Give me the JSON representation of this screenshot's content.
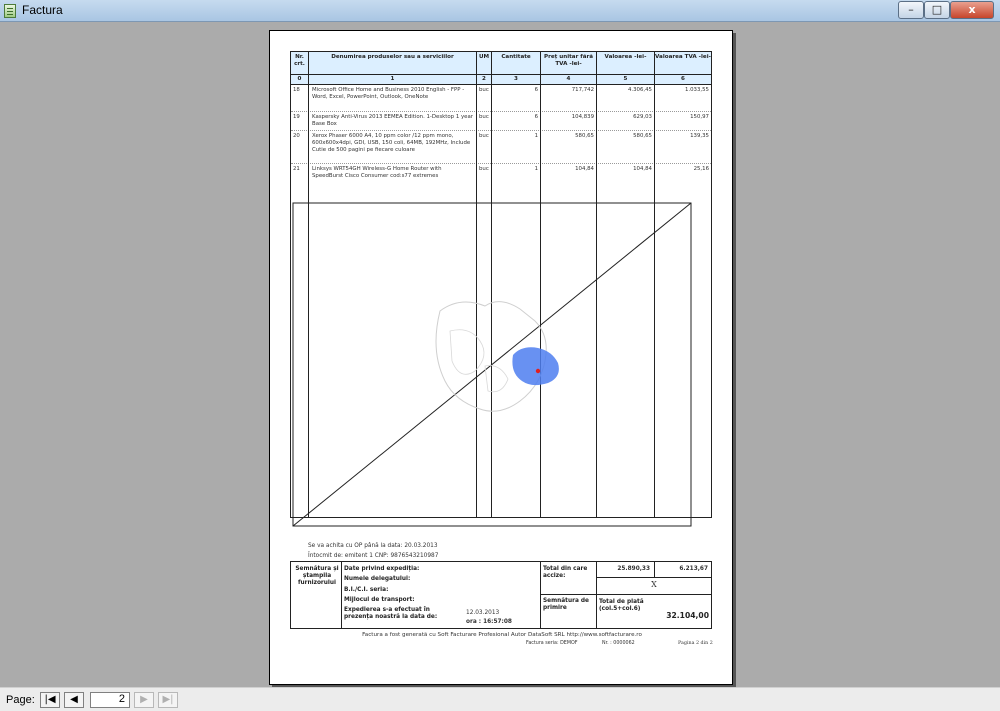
{
  "window": {
    "title": "Factura",
    "min_label": "–",
    "max_label": "□",
    "close_label": "x"
  },
  "table": {
    "headers": [
      "Nr. crt.",
      "Denumirea produselor sau a serviciilor",
      "UM",
      "Cantitate",
      "Preț unitar fără TVA -lei-",
      "Valoarea -lei-",
      "Valoarea TVA -lei-"
    ],
    "col_numbers": [
      "0",
      "1",
      "2",
      "3",
      "4",
      "5",
      "6"
    ],
    "rows": [
      {
        "nr": "18",
        "name": "Microsoft Office Home and Business 2010 English - FPP - Word, Excel, PowerPoint, Outlook, OneNote",
        "um": "buc",
        "qty": "6",
        "price": "717,742",
        "value": "4.306,45",
        "vat": "1.033,55"
      },
      {
        "nr": "19",
        "name": "Kaspersky Anti-Virus 2013 EEMEA Edition. 1-Desktop 1 year Base Box",
        "um": "buc",
        "qty": "6",
        "price": "104,839",
        "value": "629,03",
        "vat": "150,97"
      },
      {
        "nr": "20",
        "name": "Xerox Phaser 6000 A4, 10 ppm color /12 ppm mono, 600x600x4dpi, GDI, USB, 150 coli, 64MB, 192MHz, Include Cutie de 500 pagini pe fiecare culoare",
        "um": "buc",
        "qty": "1",
        "price": "580,65",
        "value": "580,65",
        "vat": "139,35"
      },
      {
        "nr": "21",
        "name": "Linksys WRT54GH Wireless-G Home Router with SpeedBurst Cisco Consumer cod:s77 extremes",
        "um": "buc",
        "qty": "1",
        "price": "104,84",
        "value": "104,84",
        "vat": "25,16"
      }
    ]
  },
  "footer": {
    "pay_note": "Se va achita cu OP până la data: 20.03.2013",
    "issuer_note": "Întocmit de: emitent 1  CNP: 9876543210987",
    "supplier_signature": "Semnătura și ștampila furnizorului",
    "dispatch_title": "Date privind expediția:",
    "delegate_label": "Numele delegatului:",
    "id_label": "B.I./C.I. seria:",
    "transport_label": "Mijlocul de transport:",
    "dispatch_presence": "Expedierea s-a efectuat în prezența noastră la data de:",
    "dispatch_date": "12.03.2013",
    "dispatch_time": "ora : 16:57:08",
    "total_label": "Total din care accize:",
    "total_value": "25.890,33",
    "total_vat": "6.213,67",
    "excise_value": "X",
    "receipt_signature": "Semnătura de primire",
    "total_pay_label": "Total de plată (col.5+col.6)",
    "total_pay_value": "32.104,00",
    "generated_by": "Factura a fost generată cu Soft Facturare Profesional Autor DataSoft SRL http://www.softfacturare.ro",
    "series": "Factura seria:  DEMOF",
    "number": "Nr.  : 0000062",
    "page_of": "Pagina 2 din 2"
  },
  "statusbar": {
    "page_label": "Page:",
    "current_page": "2",
    "first_label": "|◀",
    "prev_label": "◀",
    "next_label": "▶",
    "last_label": "▶|"
  },
  "colors": {
    "header_fill": "#dcefff",
    "map_highlight": "#4d7ef0",
    "map_marker": "#e02020"
  }
}
